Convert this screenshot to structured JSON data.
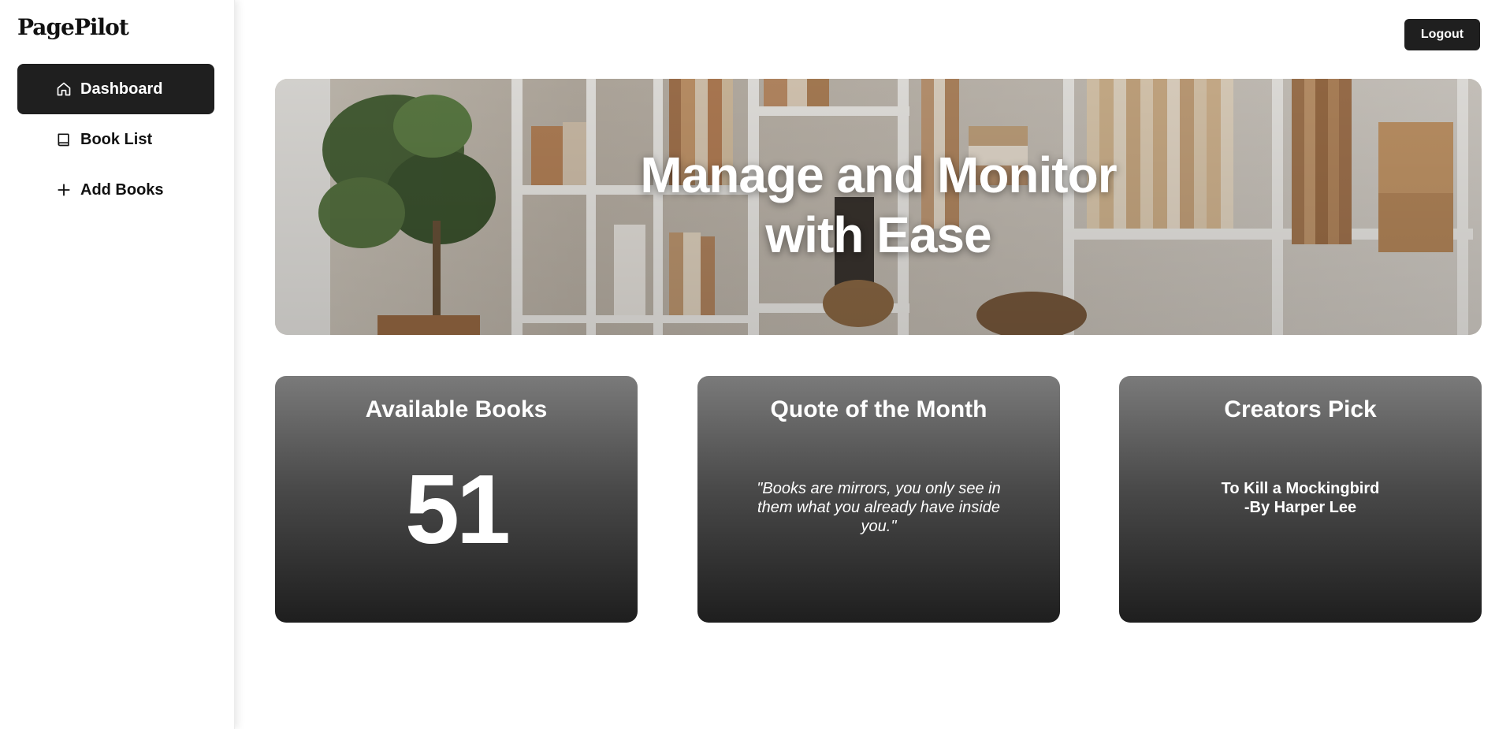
{
  "app": {
    "brand": "PagePilot"
  },
  "sidebar": {
    "items": [
      {
        "label": "Dashboard",
        "icon": "home-icon",
        "active": true
      },
      {
        "label": "Book List",
        "icon": "book-icon",
        "active": false
      },
      {
        "label": "Add Books",
        "icon": "plus-icon",
        "active": false
      }
    ]
  },
  "header": {
    "logout_label": "Logout"
  },
  "hero": {
    "title_line1": "Manage and Monitor",
    "title_line2": "with Ease",
    "image": "bookshelf-photo"
  },
  "cards": {
    "available": {
      "title": "Available Books",
      "value": "51"
    },
    "quote": {
      "title": "Quote of the Month",
      "text": "\"Books are mirrors, you only see in them what you already have inside you.\""
    },
    "pick": {
      "title": "Creators Pick",
      "book": "To Kill a Mockingbird",
      "author": "-By Harper Lee"
    }
  },
  "colors": {
    "sidebar_active_bg": "#1f1f1f",
    "button_bg": "#1f1f1f",
    "card_gradient_top": "#7a7a7a",
    "card_gradient_bottom": "#1e1e1e"
  }
}
